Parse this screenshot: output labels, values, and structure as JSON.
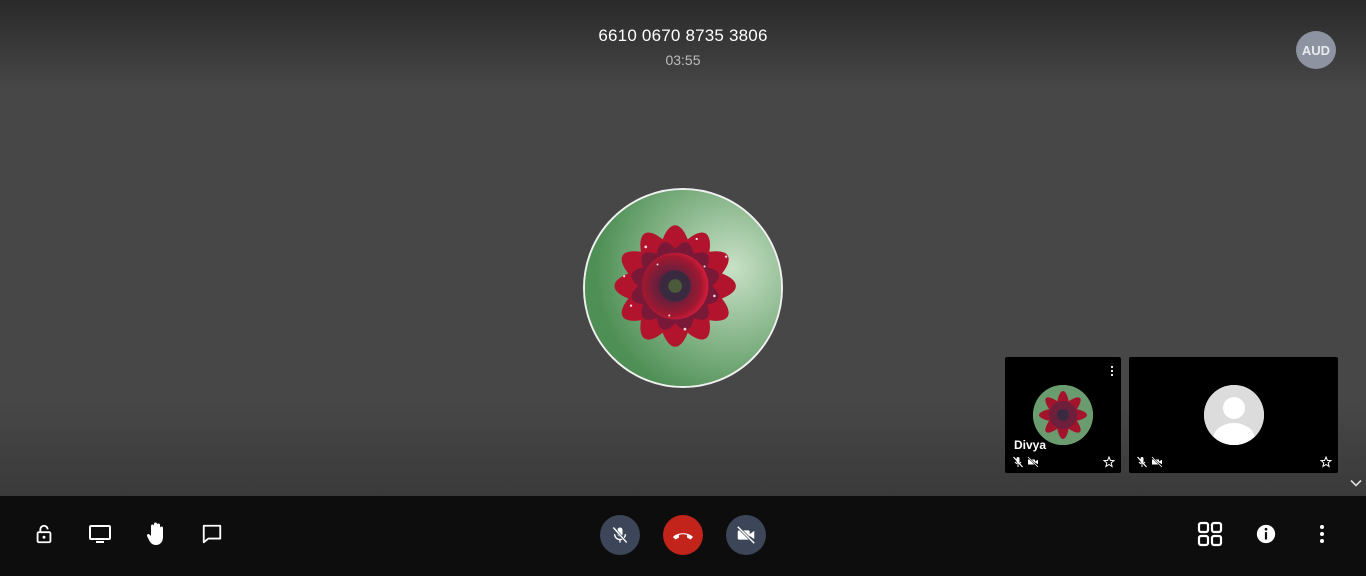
{
  "meeting": {
    "id": "6610 0670 8735 3806",
    "timer": "03:55"
  },
  "badge": {
    "label": "AUD"
  },
  "main_avatar": {
    "icon": "flower-photo-avatar"
  },
  "tiles": [
    {
      "name": "Divya",
      "avatar": "flower-photo-avatar",
      "mic": "mic-muted-icon",
      "camera": "camera-off-icon",
      "pin": "star-icon",
      "menu": "more-vertical-icon"
    },
    {
      "name": "",
      "avatar": "default-person-avatar",
      "mic": "mic-muted-icon",
      "camera": "camera-off-icon",
      "pin": "star-icon"
    }
  ],
  "toolbar": {
    "left": [
      "unlock-icon",
      "screen-share-icon",
      "raise-hand-icon",
      "chat-icon"
    ],
    "center": [
      "mic-muted-icon",
      "hang-up-icon",
      "camera-off-icon"
    ],
    "right": [
      "grid-view-icon",
      "info-icon",
      "more-vertical-icon"
    ]
  },
  "colors": {
    "stage": "#474747",
    "toolbar": "#0d0d0d",
    "hangup": "#c2241b",
    "control": "#3c4658",
    "badge": "#8d93a0"
  }
}
